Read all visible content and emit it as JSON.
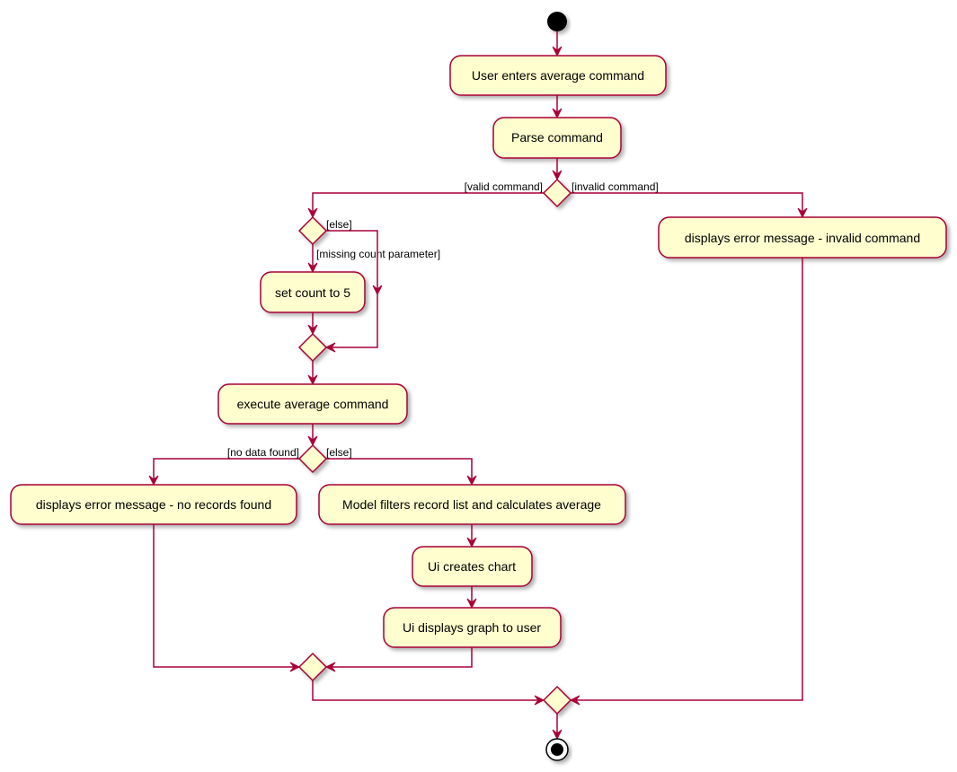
{
  "colors": {
    "fill": "#FEFECE",
    "stroke": "#A80036",
    "node": "#000000"
  },
  "activities": {
    "user_enters": "User enters average command",
    "parse": "Parse command",
    "invalid_error": "displays error message - invalid command",
    "set_count": "set count to 5",
    "execute": "execute average command",
    "no_records_error": "displays error message - no records found",
    "model_filters": "Model filters record list and calculates average",
    "ui_chart": "Ui creates chart",
    "ui_display": "Ui displays graph to user"
  },
  "guards": {
    "valid": "[valid command]",
    "invalid": "[invalid command]",
    "else1": "[else]",
    "missing": "[missing count parameter]",
    "no_data": "[no data found]",
    "else2": "[else]"
  }
}
